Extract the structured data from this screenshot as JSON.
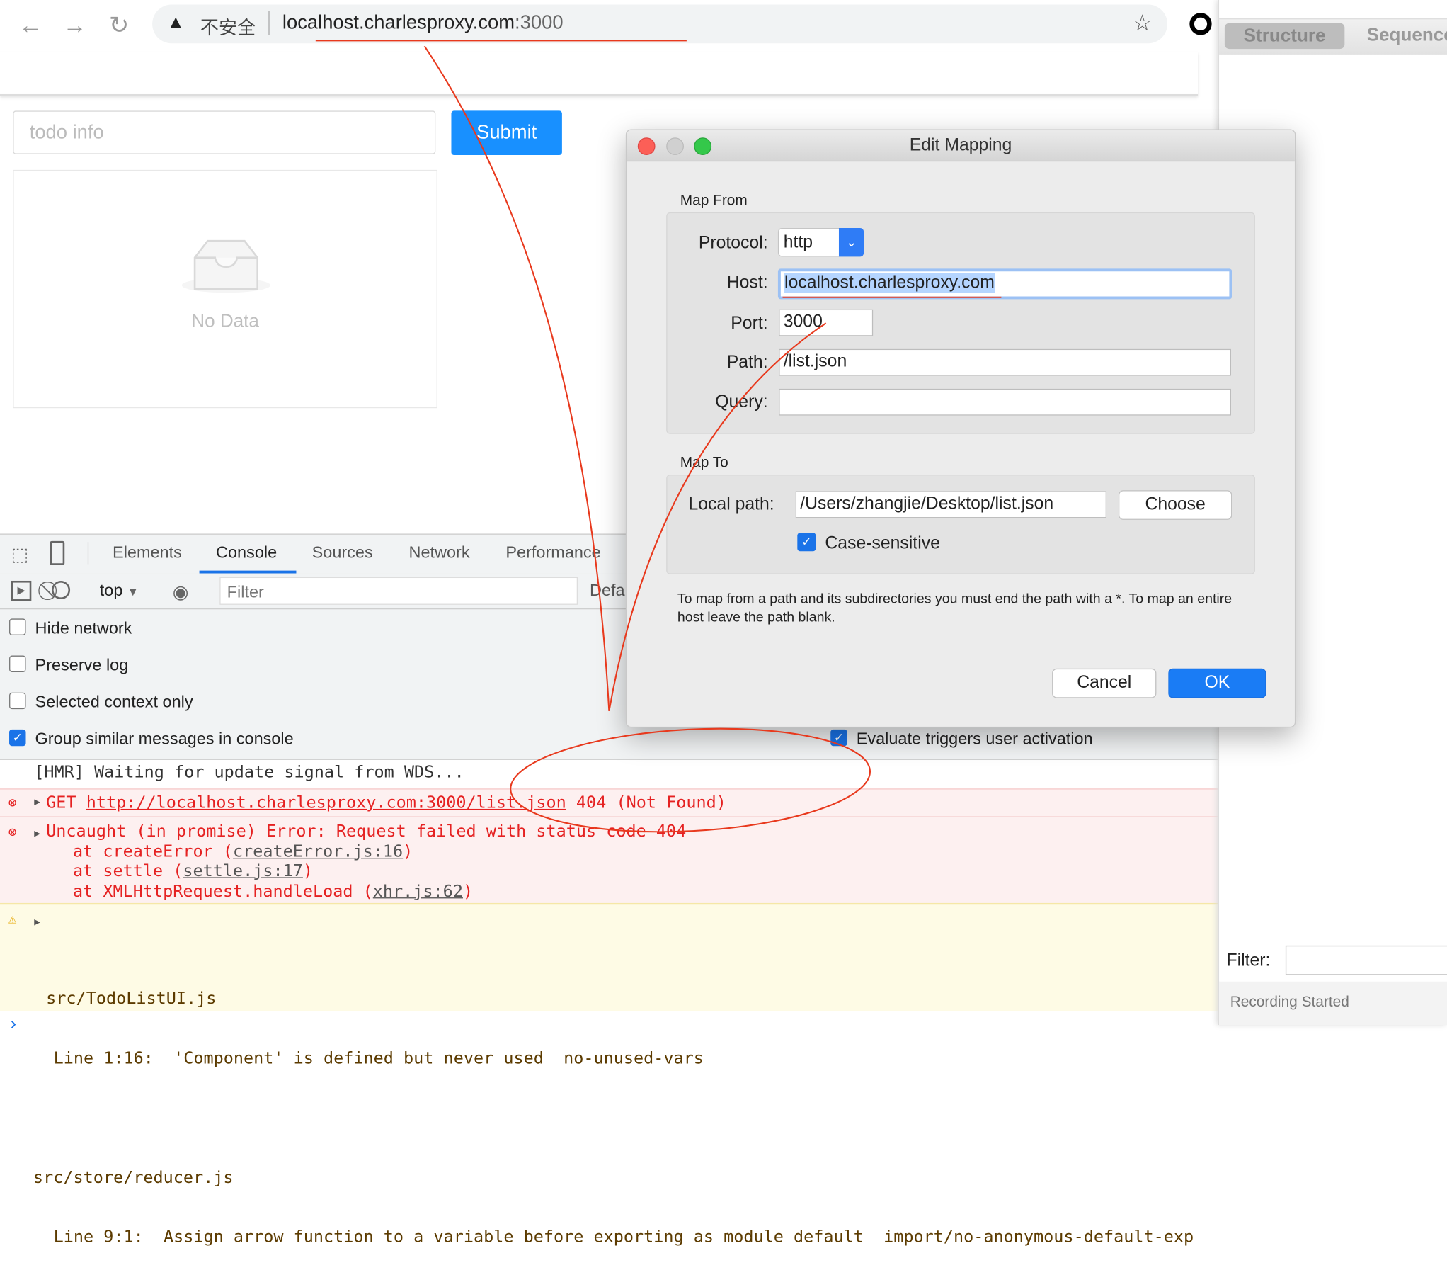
{
  "browser": {
    "security_label": "不安全",
    "url_host": "localhost.charlesproxy.com",
    "url_port": ":3000"
  },
  "app": {
    "todo_placeholder": "todo info",
    "submit_label": "Submit",
    "empty_text": "No Data"
  },
  "devtools": {
    "tabs": [
      "Elements",
      "Console",
      "Sources",
      "Network",
      "Performance"
    ],
    "active_tab": "Console",
    "context": "top",
    "filter_placeholder": "Filter",
    "levels_label": "Defa",
    "settings": [
      {
        "label": "Hide network",
        "checked": false
      },
      {
        "label": "Preserve log",
        "checked": false
      },
      {
        "label": "Selected context only",
        "checked": false
      },
      {
        "label": "Group similar messages in console",
        "checked": true
      }
    ],
    "evaluate_triggers": {
      "label": "Evaluate triggers user activation",
      "checked": true
    },
    "console": {
      "hmr": "[HMR] Waiting for update signal from WDS...",
      "get_error": {
        "method": "GET",
        "url": "http://localhost.charlesproxy.com:3000/list.json",
        "status": "404 (Not Found)"
      },
      "uncaught": {
        "message": "Uncaught (in promise) Error: Request failed with status code 404",
        "stack": [
          {
            "prefix": "at createError (",
            "link": "createError.js:16",
            "suffix": ")"
          },
          {
            "prefix": "at settle (",
            "link": "settle.js:17",
            "suffix": ")"
          },
          {
            "prefix": "at XMLHttpRequest.handleLoad (",
            "link": "xhr.js:62",
            "suffix": ")"
          }
        ]
      },
      "warning": {
        "file1": "src/TodoListUI.js",
        "line1": "Line 1:16:  'Component' is defined but never used  no-unused-vars",
        "file2": "src/store/reducer.js",
        "line2": "Line 9:1:  Assign arrow function to a variable before exporting as module default  import/no-anonymous-default-exp"
      },
      "prompt": "›"
    }
  },
  "charles": {
    "tabs": [
      "Structure",
      "Sequence"
    ],
    "filter_label": "Filter:",
    "status": "Recording Started"
  },
  "dialog": {
    "title": "Edit Mapping",
    "map_from_label": "Map From",
    "protocol_label": "Protocol:",
    "protocol_value": "http",
    "host_label": "Host:",
    "host_value": "localhost.charlesproxy.com",
    "port_label": "Port:",
    "port_value": "3000",
    "path_label": "Path:",
    "path_value": "/list.json",
    "query_label": "Query:",
    "query_value": "",
    "map_to_label": "Map To",
    "local_path_label": "Local path:",
    "local_path_value": "/Users/zhangjie/Desktop/list.json",
    "choose_label": "Choose",
    "case_sensitive_label": "Case-sensitive",
    "case_sensitive_checked": true,
    "hint": "To map from a path and its subdirectories you must end the path with a *. To map an entire host leave the path blank.",
    "cancel_label": "Cancel",
    "ok_label": "OK"
  },
  "colors": {
    "accent": "#1a73e8",
    "submit": "#1890ff",
    "error": "#e52222",
    "annotation": "#e8391d",
    "ok_button": "#1a7cf5"
  }
}
